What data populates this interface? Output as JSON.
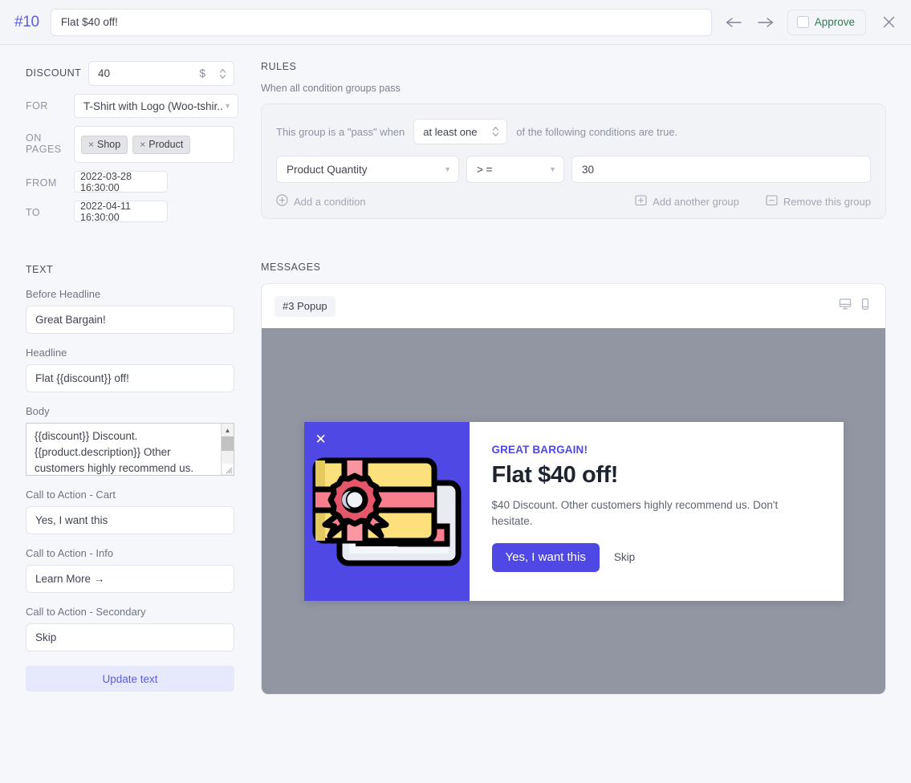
{
  "header": {
    "number": "#10",
    "title_value": "Flat $40 off!",
    "title_placeholder": "Title",
    "prev_icon": "arrow-left-icon",
    "next_icon": "arrow-right-icon",
    "approve_label": "Approve",
    "approve_color": "#2f7d55",
    "close_icon": "close-icon"
  },
  "discount": {
    "label": "DISCOUNT",
    "value": "40",
    "unit": "$"
  },
  "for": {
    "label": "FOR",
    "value": "T-Shirt with Logo (Woo-tshir..."
  },
  "on_pages": {
    "label": "ON PAGES",
    "tags": [
      "Shop",
      "Product"
    ],
    "remove_glyph": "×"
  },
  "from": {
    "label": "FROM",
    "value": "2022-03-28 16:30:00"
  },
  "to": {
    "label": "TO",
    "value": "2022-04-11 16:30:00"
  },
  "rules": {
    "title": "RULES",
    "subtitle": "When all condition groups pass",
    "group_prefix": "This group is a \"pass\" when",
    "quantifier": "at least one",
    "group_suffix": "of the following conditions are true.",
    "condition": {
      "field": "Product Quantity",
      "operator": "> =",
      "value": "30"
    },
    "add_condition": "Add a condition",
    "add_group": "Add another group",
    "remove_group": "Remove this group"
  },
  "text": {
    "title": "TEXT",
    "fields": [
      {
        "label": "Before Headline",
        "value": "Great Bargain!"
      },
      {
        "label": "Headline",
        "value": "Flat {{discount}} off!"
      }
    ],
    "body": {
      "label": "Body",
      "value": "{{discount}} Discount. {{product.description}} Other customers highly recommend us."
    },
    "cta_cart": {
      "label": "Call to Action - Cart",
      "value": "Yes, I want this"
    },
    "cta_info": {
      "label": "Call to Action - Info",
      "value": "Learn More →"
    },
    "cta_secondary": {
      "label": "Call to Action - Secondary",
      "value": "Skip"
    },
    "update_button": "Update text"
  },
  "messages": {
    "title": "MESSAGES",
    "badge": "#3 Popup",
    "desktop_icon": "monitor-icon",
    "mobile_icon": "phone-icon",
    "preview_bg": "#9296a3",
    "popup": {
      "accent": "#5048e5",
      "close_glyph": "✕",
      "pre_headline": "GREAT BARGAIN!",
      "headline": "Flat $40 off!",
      "body": "$40 Discount. Other customers highly recommend us. Don't hesitate.",
      "cta_primary": "Yes, I want this",
      "cta_secondary": "Skip"
    }
  }
}
